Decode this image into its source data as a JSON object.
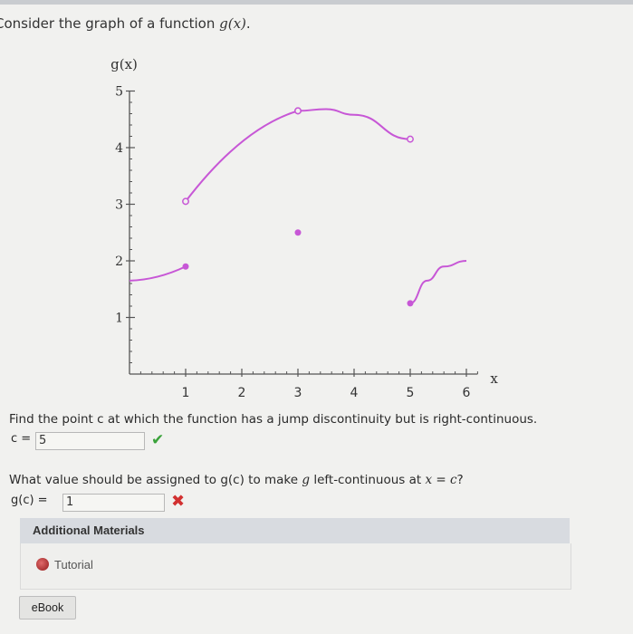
{
  "question": {
    "intro_text": "Consider the graph of a function ",
    "intro_func": "g(x)",
    "intro_end": "."
  },
  "chart_data": {
    "type": "line",
    "ylabel": "g(x)",
    "xlabel": "x",
    "x_ticks": [
      "1",
      "2",
      "3",
      "4",
      "5",
      "6"
    ],
    "y_ticks": [
      "1",
      "2",
      "3",
      "4",
      "5"
    ],
    "xlim": [
      0,
      6.2
    ],
    "ylim": [
      0,
      5
    ],
    "series": [
      {
        "points": [
          [
            0,
            1.65
          ],
          [
            0.5,
            1.72
          ],
          [
            1,
            1.9
          ]
        ],
        "start": "closed",
        "end": "closed",
        "start_dot": false
      },
      {
        "points": [
          [
            1,
            3.05
          ],
          [
            2,
            4.1
          ],
          [
            3,
            4.65
          ]
        ],
        "start": "open",
        "end": "open",
        "start_dot": true
      },
      {
        "points": [
          [
            3,
            4.65
          ],
          [
            3.5,
            4.68
          ],
          [
            4,
            4.58
          ],
          [
            5,
            4.15
          ]
        ],
        "start": "open",
        "end": "open",
        "start_dot": true
      },
      {
        "points": [
          [
            5,
            1.25
          ],
          [
            5.3,
            1.65
          ],
          [
            5.6,
            1.9
          ],
          [
            6,
            2.0
          ]
        ],
        "start": "closed",
        "end": "none",
        "start_dot": true
      }
    ],
    "isolated_points": [
      [
        3,
        2.5
      ]
    ],
    "color": "#c757d6"
  },
  "q1": {
    "text": "Find the point c at which the function has a jump discontinuity but is right-continuous.",
    "label": "c =",
    "value": "5",
    "status": "✔"
  },
  "q2": {
    "text_a": "What value should be assigned to ",
    "func": "g(c)",
    "text_b": " to make ",
    "g": "g",
    "text_c": " left-continuous at ",
    "cond": "x = c",
    "text_d": "?",
    "label": "g(c) =",
    "value": "1",
    "status": "✖"
  },
  "materials": {
    "header": "Additional Materials",
    "tutorial": "Tutorial",
    "ebook": "eBook"
  }
}
